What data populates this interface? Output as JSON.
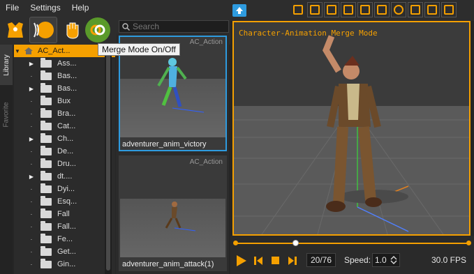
{
  "menu": {
    "file": "File",
    "settings": "Settings",
    "help": "Help"
  },
  "search": {
    "placeholder": "Search"
  },
  "tabs": {
    "library": "Library",
    "favorite": "Favorite"
  },
  "tooltip": "Merge Mode On/Off",
  "tree": {
    "root": "AC_Act...",
    "items": [
      {
        "label": "Ass...",
        "expandable": true
      },
      {
        "label": "Bas...",
        "expandable": false
      },
      {
        "label": "Bas...",
        "expandable": true
      },
      {
        "label": "Bux",
        "expandable": false
      },
      {
        "label": "Bra...",
        "expandable": false
      },
      {
        "label": "Cat...",
        "expandable": false
      },
      {
        "label": "Ch...",
        "expandable": true
      },
      {
        "label": "De...",
        "expandable": false
      },
      {
        "label": "Dru...",
        "expandable": false
      },
      {
        "label": "dt....",
        "expandable": true
      },
      {
        "label": "Dyi...",
        "expandable": false
      },
      {
        "label": "Esq...",
        "expandable": false
      },
      {
        "label": "Fall",
        "expandable": false
      },
      {
        "label": "Fall...",
        "expandable": false
      },
      {
        "label": "Fe...",
        "expandable": false
      },
      {
        "label": "Get...",
        "expandable": false
      },
      {
        "label": "Gin...",
        "expandable": false
      }
    ]
  },
  "thumbs": [
    {
      "category": "AC_Action",
      "name": "adventurer_anim_victory",
      "selected": true
    },
    {
      "category": "AC_Action",
      "name": "adventurer_anim_attack(1)",
      "selected": false
    }
  ],
  "viewport": {
    "title": "Character-Animation Merge Mode"
  },
  "playback": {
    "counter": "20/76",
    "speed_label": "Speed:",
    "speed": "1.0",
    "fps": "30.0 FPS",
    "progress": 0.26
  },
  "colors": {
    "accent": "#f5a000",
    "select": "#2e9bdf"
  }
}
